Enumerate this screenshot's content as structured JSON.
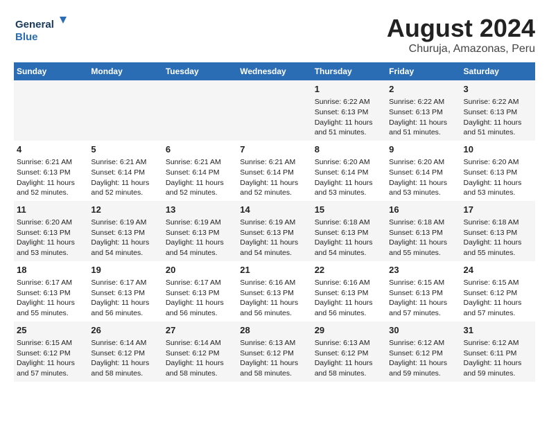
{
  "logo": {
    "line1": "General",
    "line2": "Blue"
  },
  "title": "August 2024",
  "subtitle": "Churuja, Amazonas, Peru",
  "days_of_week": [
    "Sunday",
    "Monday",
    "Tuesday",
    "Wednesday",
    "Thursday",
    "Friday",
    "Saturday"
  ],
  "weeks": [
    [
      {
        "day": "",
        "content": ""
      },
      {
        "day": "",
        "content": ""
      },
      {
        "day": "",
        "content": ""
      },
      {
        "day": "",
        "content": ""
      },
      {
        "day": "1",
        "content": "Sunrise: 6:22 AM\nSunset: 6:13 PM\nDaylight: 11 hours\nand 51 minutes."
      },
      {
        "day": "2",
        "content": "Sunrise: 6:22 AM\nSunset: 6:13 PM\nDaylight: 11 hours\nand 51 minutes."
      },
      {
        "day": "3",
        "content": "Sunrise: 6:22 AM\nSunset: 6:13 PM\nDaylight: 11 hours\nand 51 minutes."
      }
    ],
    [
      {
        "day": "4",
        "content": "Sunrise: 6:21 AM\nSunset: 6:13 PM\nDaylight: 11 hours\nand 52 minutes."
      },
      {
        "day": "5",
        "content": "Sunrise: 6:21 AM\nSunset: 6:14 PM\nDaylight: 11 hours\nand 52 minutes."
      },
      {
        "day": "6",
        "content": "Sunrise: 6:21 AM\nSunset: 6:14 PM\nDaylight: 11 hours\nand 52 minutes."
      },
      {
        "day": "7",
        "content": "Sunrise: 6:21 AM\nSunset: 6:14 PM\nDaylight: 11 hours\nand 52 minutes."
      },
      {
        "day": "8",
        "content": "Sunrise: 6:20 AM\nSunset: 6:14 PM\nDaylight: 11 hours\nand 53 minutes."
      },
      {
        "day": "9",
        "content": "Sunrise: 6:20 AM\nSunset: 6:14 PM\nDaylight: 11 hours\nand 53 minutes."
      },
      {
        "day": "10",
        "content": "Sunrise: 6:20 AM\nSunset: 6:13 PM\nDaylight: 11 hours\nand 53 minutes."
      }
    ],
    [
      {
        "day": "11",
        "content": "Sunrise: 6:20 AM\nSunset: 6:13 PM\nDaylight: 11 hours\nand 53 minutes."
      },
      {
        "day": "12",
        "content": "Sunrise: 6:19 AM\nSunset: 6:13 PM\nDaylight: 11 hours\nand 54 minutes."
      },
      {
        "day": "13",
        "content": "Sunrise: 6:19 AM\nSunset: 6:13 PM\nDaylight: 11 hours\nand 54 minutes."
      },
      {
        "day": "14",
        "content": "Sunrise: 6:19 AM\nSunset: 6:13 PM\nDaylight: 11 hours\nand 54 minutes."
      },
      {
        "day": "15",
        "content": "Sunrise: 6:18 AM\nSunset: 6:13 PM\nDaylight: 11 hours\nand 54 minutes."
      },
      {
        "day": "16",
        "content": "Sunrise: 6:18 AM\nSunset: 6:13 PM\nDaylight: 11 hours\nand 55 minutes."
      },
      {
        "day": "17",
        "content": "Sunrise: 6:18 AM\nSunset: 6:13 PM\nDaylight: 11 hours\nand 55 minutes."
      }
    ],
    [
      {
        "day": "18",
        "content": "Sunrise: 6:17 AM\nSunset: 6:13 PM\nDaylight: 11 hours\nand 55 minutes."
      },
      {
        "day": "19",
        "content": "Sunrise: 6:17 AM\nSunset: 6:13 PM\nDaylight: 11 hours\nand 56 minutes."
      },
      {
        "day": "20",
        "content": "Sunrise: 6:17 AM\nSunset: 6:13 PM\nDaylight: 11 hours\nand 56 minutes."
      },
      {
        "day": "21",
        "content": "Sunrise: 6:16 AM\nSunset: 6:13 PM\nDaylight: 11 hours\nand 56 minutes."
      },
      {
        "day": "22",
        "content": "Sunrise: 6:16 AM\nSunset: 6:13 PM\nDaylight: 11 hours\nand 56 minutes."
      },
      {
        "day": "23",
        "content": "Sunrise: 6:15 AM\nSunset: 6:13 PM\nDaylight: 11 hours\nand 57 minutes."
      },
      {
        "day": "24",
        "content": "Sunrise: 6:15 AM\nSunset: 6:12 PM\nDaylight: 11 hours\nand 57 minutes."
      }
    ],
    [
      {
        "day": "25",
        "content": "Sunrise: 6:15 AM\nSunset: 6:12 PM\nDaylight: 11 hours\nand 57 minutes."
      },
      {
        "day": "26",
        "content": "Sunrise: 6:14 AM\nSunset: 6:12 PM\nDaylight: 11 hours\nand 58 minutes."
      },
      {
        "day": "27",
        "content": "Sunrise: 6:14 AM\nSunset: 6:12 PM\nDaylight: 11 hours\nand 58 minutes."
      },
      {
        "day": "28",
        "content": "Sunrise: 6:13 AM\nSunset: 6:12 PM\nDaylight: 11 hours\nand 58 minutes."
      },
      {
        "day": "29",
        "content": "Sunrise: 6:13 AM\nSunset: 6:12 PM\nDaylight: 11 hours\nand 58 minutes."
      },
      {
        "day": "30",
        "content": "Sunrise: 6:12 AM\nSunset: 6:12 PM\nDaylight: 11 hours\nand 59 minutes."
      },
      {
        "day": "31",
        "content": "Sunrise: 6:12 AM\nSunset: 6:11 PM\nDaylight: 11 hours\nand 59 minutes."
      }
    ]
  ]
}
